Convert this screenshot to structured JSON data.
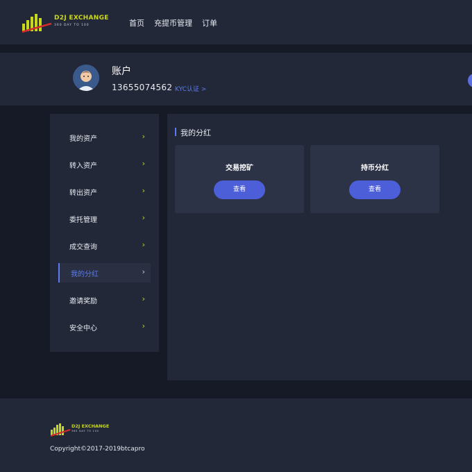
{
  "brand": {
    "name": "D2J EXCHANGE",
    "tagline": "360 DAY TO 100",
    "accent_color": "#c9d81b"
  },
  "nav": {
    "items": [
      {
        "label": "首页"
      },
      {
        "label": "充提币管理"
      },
      {
        "label": "订单"
      }
    ]
  },
  "profile": {
    "title": "账户",
    "phone": "13655074562",
    "kyc_label": "KYC认证 >",
    "avatar_icon": "user-avatar"
  },
  "sidebar": {
    "items": [
      {
        "label": "我的资产",
        "chevron": "›"
      },
      {
        "label": "转入资产",
        "chevron": "›"
      },
      {
        "label": "转出资产",
        "chevron": "›"
      },
      {
        "label": "委托管理",
        "chevron": "›"
      },
      {
        "label": "成交查询",
        "chevron": "›"
      },
      {
        "label": "我的分红",
        "chevron": "›",
        "active": true
      },
      {
        "label": "邀请奖励",
        "chevron": "›"
      },
      {
        "label": "安全中心",
        "chevron": "›"
      }
    ]
  },
  "main": {
    "section_title": "我的分红",
    "cards": [
      {
        "title": "交易挖矿",
        "button": "查看"
      },
      {
        "title": "持币分红",
        "button": "查看"
      }
    ]
  },
  "footer": {
    "copyright": "Copyright©2017-2019btcapro"
  },
  "colors": {
    "primary": "#4d5fd8",
    "link": "#5b7cf0",
    "background": "#161a26",
    "panel": "#232838"
  }
}
